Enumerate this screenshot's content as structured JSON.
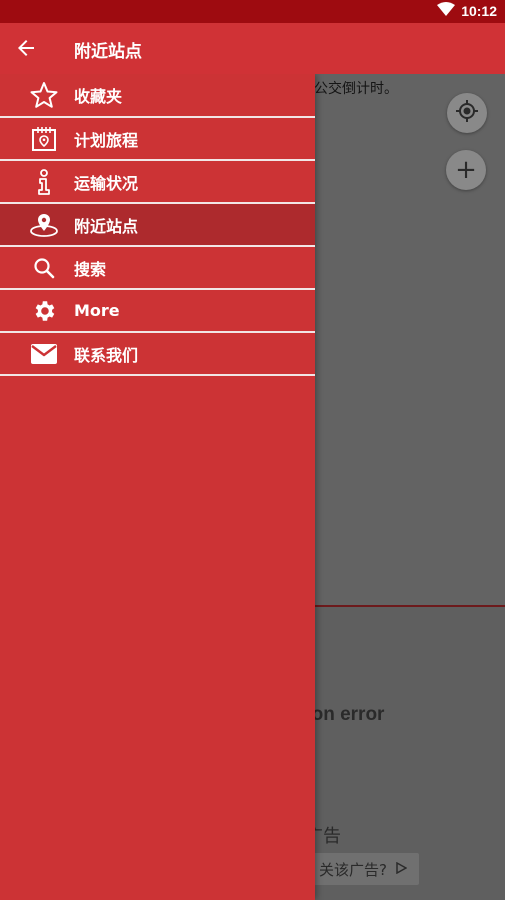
{
  "status_bar": {
    "time": "10:12"
  },
  "app_bar": {
    "title": "附近站点"
  },
  "drawer": {
    "items": [
      {
        "label": "收藏夹",
        "icon": "star-icon"
      },
      {
        "label": "计划旅程",
        "icon": "calendar-icon"
      },
      {
        "label": "运输状况",
        "icon": "info-icon"
      },
      {
        "label": "附近站点",
        "icon": "map-pin-icon",
        "active": true
      },
      {
        "label": "搜索",
        "icon": "search-icon"
      },
      {
        "label": "More",
        "icon": "gear-icon"
      },
      {
        "label": "联系我们",
        "icon": "mail-icon"
      }
    ]
  },
  "background": {
    "top_text": "亍公交倒计时。",
    "error_text": "tion error",
    "ad_label": "广告",
    "ad_button": "关该广告?"
  },
  "colors": {
    "status_bar": "#9e0b10",
    "primary": "#d03236",
    "drawer": "#cc3335",
    "active_item": "#ad2a2d"
  }
}
